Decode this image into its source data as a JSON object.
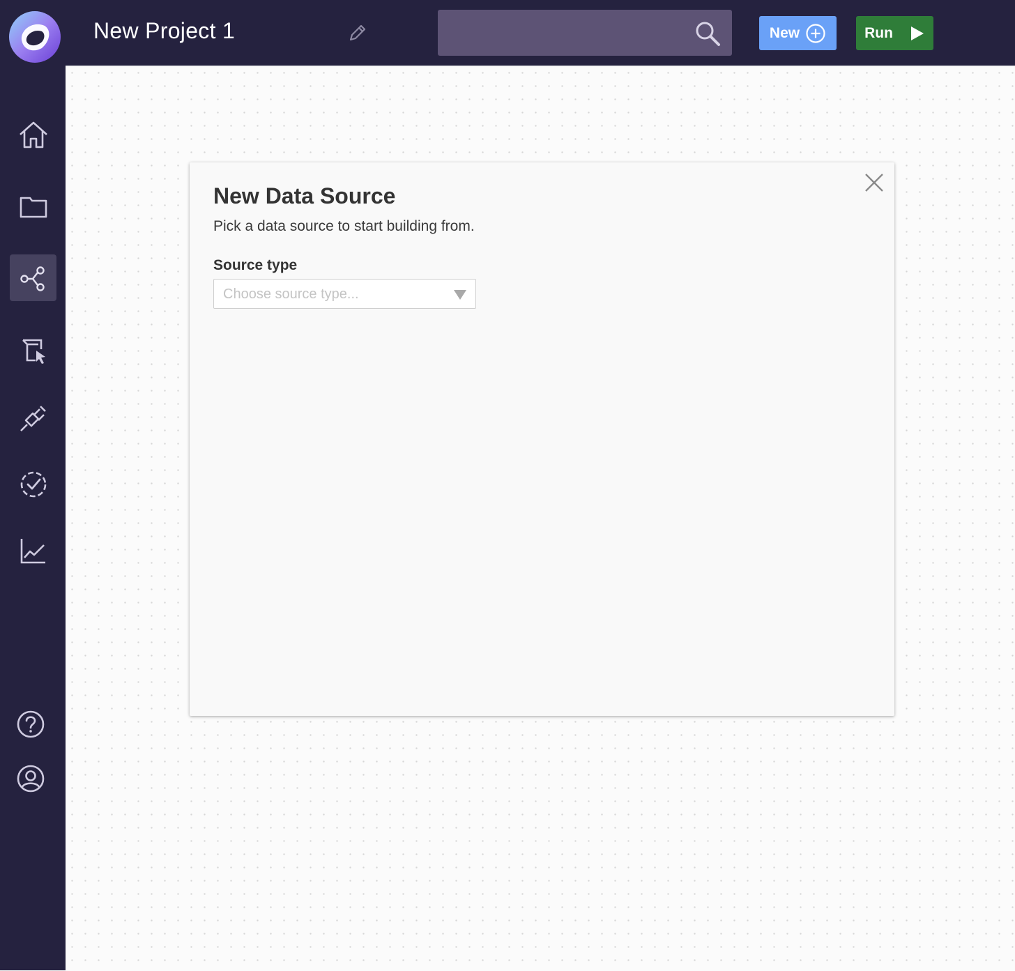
{
  "header": {
    "project_title": "New Project 1",
    "search_placeholder": "",
    "new_label": "New",
    "run_label": "Run"
  },
  "sidebar": {
    "items": [
      {
        "name": "home",
        "icon": "home-icon"
      },
      {
        "name": "projects",
        "icon": "folder-icon"
      },
      {
        "name": "pipelines",
        "icon": "graph-icon",
        "active": true
      },
      {
        "name": "catalog",
        "icon": "cursor-box-icon"
      },
      {
        "name": "integrations",
        "icon": "plug-icon"
      },
      {
        "name": "validation",
        "icon": "check-circle-icon"
      },
      {
        "name": "analytics",
        "icon": "chart-icon"
      },
      {
        "name": "help",
        "icon": "help-icon"
      },
      {
        "name": "account",
        "icon": "user-icon"
      }
    ]
  },
  "modal": {
    "title": "New Data Source",
    "subtitle": "Pick a data source to start building from.",
    "field_label": "Source type",
    "select_placeholder": "Choose source type..."
  },
  "colors": {
    "header_bg": "#25223f",
    "search_bg": "#5d5375",
    "new_button": "#6aa1f7",
    "run_button": "#2f7d39",
    "active_nav": "#46425f"
  }
}
